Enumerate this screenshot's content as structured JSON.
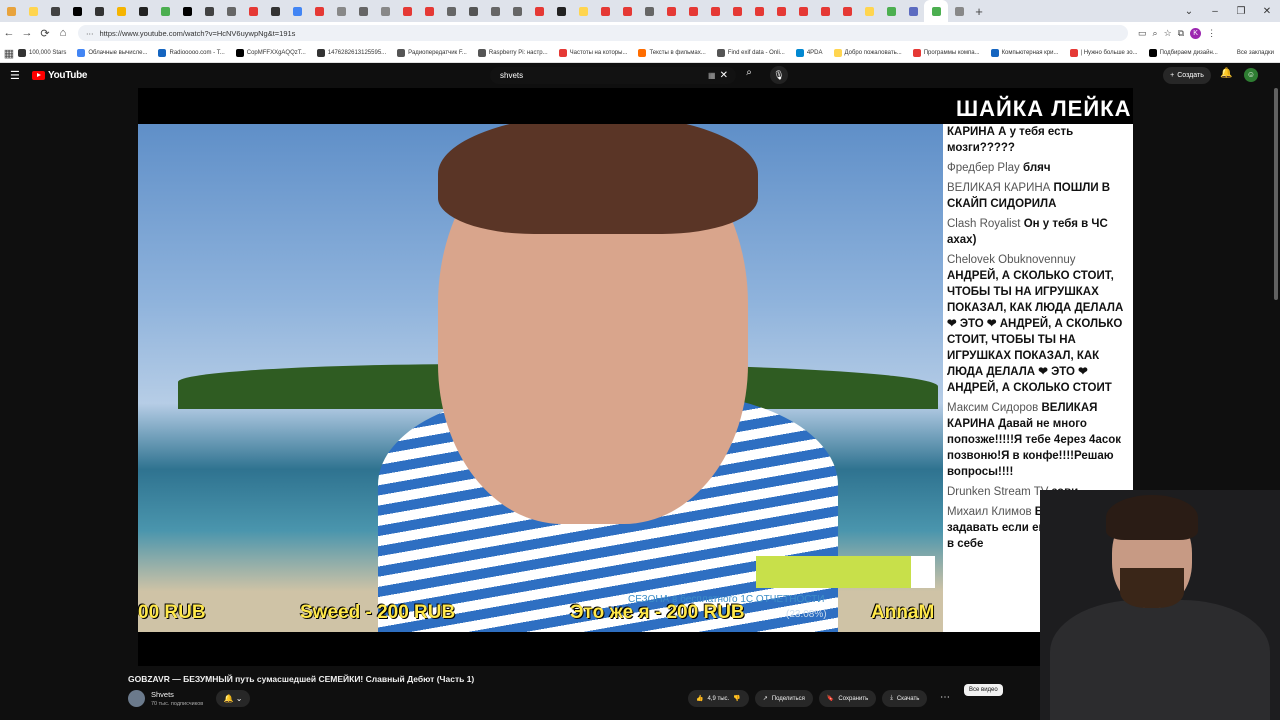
{
  "browser": {
    "tab_favicon_colors": [
      "#e8a33d",
      "#ffd54f",
      "#424242",
      "#000000",
      "#333333",
      "#f5b400",
      "#222222",
      "#4caf50",
      "#000000",
      "#424242",
      "#666666",
      "#e53935",
      "#333333",
      "#4285f4",
      "#e53935",
      "#888888",
      "#666666",
      "#888888",
      "#e53935",
      "#e53935",
      "#666666",
      "#555555",
      "#666666",
      "#666666",
      "#e53935",
      "#222222",
      "#ffd54f",
      "#e53935",
      "#e53935",
      "#666666",
      "#e53935",
      "#e53935",
      "#e53935",
      "#e53935",
      "#e53935",
      "#e53935",
      "#e53935",
      "#e53935",
      "#e53935",
      "#ffd54f",
      "#4caf50",
      "#5c6bc0",
      "#4caf50",
      "#888888"
    ],
    "new_tab": "+",
    "window_controls": [
      "⌄",
      "–",
      "❐",
      "✕"
    ],
    "nav": {
      "back": "←",
      "forward": "→",
      "reload": "⟳",
      "home": "⌂"
    },
    "url": "https://www.youtube.com/watch?v=HcNV6uywpNg&t=191s",
    "url_icon": "⋯",
    "profile_initial": "K",
    "bookmarks": [
      {
        "label": "100,000 Stars",
        "color": "#333"
      },
      {
        "label": "Облачные вычисле...",
        "color": "#4285f4"
      },
      {
        "label": "Radiooooo.com - T...",
        "color": "#1565c0"
      },
      {
        "label": "CopMFFXXgAQQzT...",
        "color": "#000"
      },
      {
        "label": "1476282613125595...",
        "color": "#333"
      },
      {
        "label": "Радиопередатчик F...",
        "color": "#555"
      },
      {
        "label": "Raspberry Pi: настр...",
        "color": "#555"
      },
      {
        "label": "Частоты на которы...",
        "color": "#e53935"
      },
      {
        "label": "Тексты в фильмах...",
        "color": "#ff6d00"
      },
      {
        "label": "Find exif data - Onli...",
        "color": "#555"
      },
      {
        "label": "4PDA",
        "color": "#0288d1"
      },
      {
        "label": "Добро пожаловать...",
        "color": "#ffd54f"
      },
      {
        "label": "Программы компа...",
        "color": "#e53935"
      },
      {
        "label": "Компьютерная кри...",
        "color": "#1565c0"
      },
      {
        "label": "| Нужно больше зо...",
        "color": "#e53935"
      },
      {
        "label": "Подбираем дизайн...",
        "color": "#000"
      }
    ],
    "all_bookmarks": "Все закладки"
  },
  "youtube": {
    "logo": "YouTube",
    "search_query": "shvets",
    "search_kb": "▦",
    "search_clear": "✕",
    "search_icon": "🔍",
    "mic_icon": "🎤",
    "create_label": "Создать",
    "create_icon": "+",
    "bell_icon": "🔔",
    "avatar_initial": "☺"
  },
  "video": {
    "overlay_logo": "ШАЙКА ЛЕЙКА",
    "ticker": [
      {
        "text": "00 RUB"
      },
      {
        "text": "Sweed - 200 RUB"
      },
      {
        "text": "Это же я - 200 RUB"
      },
      {
        "text": "AnnaM"
      }
    ],
    "percent": "(23.08%)",
    "scroll_text": "СЕЗОНА в бесплатного 1С ОТЧЕТНОСТИ",
    "chat": [
      {
        "user": "",
        "body": "КАРИНА А у тебя есть мозги?????"
      },
      {
        "user": "Фредбер Play",
        "body": "бляч"
      },
      {
        "user": "ВЕЛИКАЯ КАРИНА",
        "body": "ПОШЛИ В СКАЙП СИДОРИЛА"
      },
      {
        "user": "Clash Royalist",
        "body": "Он у тебя в ЧС ахах)"
      },
      {
        "user": "Chelovek Obuknovennuy",
        "body": "АНДРЕЙ, А СКОЛЬКО СТОИТ, ЧТОБЫ ТЫ НА ИГРУШКАХ ПОКАЗАЛ, КАК ЛЮДА ДЕЛАЛА ❤ ЭТО ❤ АНДРЕЙ, А СКОЛЬКО СТОИТ, ЧТОБЫ ТЫ НА ИГРУШКАХ ПОКАЗАЛ, КАК ЛЮДА ДЕЛАЛА ❤ ЭТО ❤ АНДРЕЙ, А СКОЛЬКО СТОИТ"
      },
      {
        "user": "Максим Сидоров",
        "body": "ВЕЛИКАЯ КАРИНА Давай не много попозже!!!!!Я тебе 4ерез 4асок позвоню!Я в конфе!!!!Решаю вопросы!!!!"
      },
      {
        "user": "Drunken Stream TV",
        "body": "зови"
      },
      {
        "user": "Михаил Климов",
        "body": "В смысл задавать если его нет, зн бесит в себе"
      }
    ]
  },
  "below": {
    "title": "GOBZAVR — БЕЗУМНЫЙ путь сумасшедшей СЕМЕЙКИ! Славный Дебют (Часть 1)",
    "channel": "Shvets",
    "subs": "70 тыс. подписчиков",
    "sub_bell": "🔔 ⌄",
    "likes": "4,9 тыс.",
    "like_icon": "👍",
    "dislike_icon": "👎",
    "share": "Поделиться",
    "share_icon": "↗",
    "save": "Сохранить",
    "save_icon": "🔖",
    "download": "Скачать",
    "download_icon": "⤓",
    "more": "⋯",
    "all_videos": "Все видео"
  }
}
